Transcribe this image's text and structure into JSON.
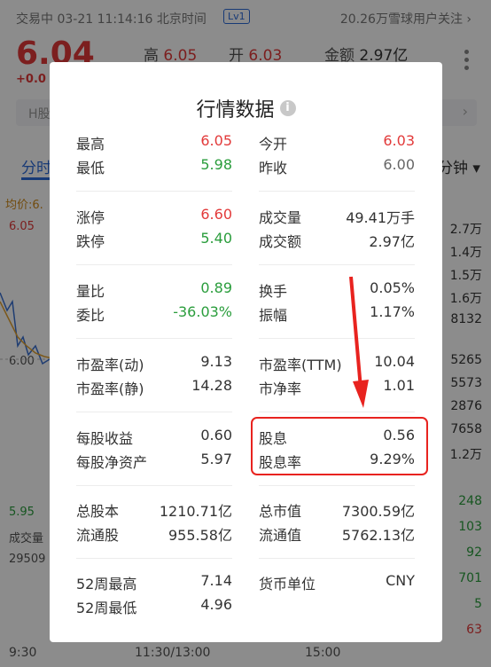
{
  "background": {
    "status_text": "交易中 03-21 11:14:16 北京时间",
    "level_badge": "Lv1",
    "followers": "20.26万雪球用户关注 ›",
    "price": "6.04",
    "change": "+0.0",
    "header": {
      "high_label": "高",
      "high_value": "6.05",
      "open_label": "开",
      "open_value": "6.03",
      "amount_label": "金额",
      "amount_value": "2.97亿"
    },
    "h_share_label": "H股",
    "tab_fenshi": "分时",
    "tab_minutes": "分钟 ▾",
    "avg_label": "均价:6.",
    "axis_high": "6.05",
    "axis_mid": "6.00",
    "axis_low": "5.95",
    "volume_label": "成交量",
    "volume_value": "29509",
    "right_col_top": [
      "2.7万",
      "1.4万",
      "1.5万",
      "1.6万",
      "8132"
    ],
    "right_col_mid": [
      "5265",
      "5573",
      "2876",
      "7658",
      "1.2万"
    ],
    "right_col_bottom": [
      "248",
      "103",
      "92",
      "701",
      "5",
      "63"
    ],
    "times": [
      "9:30",
      "11:30/13:00",
      "15:00"
    ]
  },
  "modal": {
    "title": "行情数据",
    "info_icon": "info-icon",
    "groups": [
      {
        "left": [
          {
            "label": "最高",
            "value": "6.05",
            "color": "red"
          },
          {
            "label": "最低",
            "value": "5.98",
            "color": "green"
          }
        ],
        "right": [
          {
            "label": "今开",
            "value": "6.03",
            "color": "red"
          },
          {
            "label": "昨收",
            "value": "6.00",
            "color": "gray"
          }
        ]
      },
      {
        "left": [
          {
            "label": "涨停",
            "value": "6.60",
            "color": "red"
          },
          {
            "label": "跌停",
            "value": "5.40",
            "color": "green"
          }
        ],
        "right": [
          {
            "label": "成交量",
            "value": "49.41万手",
            "color": "black"
          },
          {
            "label": "成交额",
            "value": "2.97亿",
            "color": "black"
          }
        ]
      },
      {
        "left": [
          {
            "label": "量比",
            "value": "0.89",
            "color": "green"
          },
          {
            "label": "委比",
            "value": "-36.03%",
            "color": "green"
          }
        ],
        "right": [
          {
            "label": "换手",
            "value": "0.05%",
            "color": "black"
          },
          {
            "label": "振幅",
            "value": "1.17%",
            "color": "black"
          }
        ]
      },
      {
        "left": [
          {
            "label": "市盈率(动)",
            "value": "9.13",
            "color": "black"
          },
          {
            "label": "市盈率(静)",
            "value": "14.28",
            "color": "black"
          }
        ],
        "right": [
          {
            "label": "市盈率(TTM)",
            "value": "10.04",
            "color": "black"
          },
          {
            "label": "市净率",
            "value": "1.01",
            "color": "black"
          }
        ]
      },
      {
        "left": [
          {
            "label": "每股收益",
            "value": "0.60",
            "color": "black"
          },
          {
            "label": "每股净资产",
            "value": "5.97",
            "color": "black"
          }
        ],
        "right": [
          {
            "label": "股息",
            "value": "0.56",
            "color": "black"
          },
          {
            "label": "股息率",
            "value": "9.29%",
            "color": "black"
          }
        ]
      },
      {
        "left": [
          {
            "label": "总股本",
            "value": "1210.71亿",
            "color": "black"
          },
          {
            "label": "流通股",
            "value": "955.58亿",
            "color": "black"
          }
        ],
        "right": [
          {
            "label": "总市值",
            "value": "7300.59亿",
            "color": "black"
          },
          {
            "label": "流通值",
            "value": "5762.13亿",
            "color": "black"
          }
        ]
      },
      {
        "left": [
          {
            "label": "52周最高",
            "value": "7.14",
            "color": "black"
          },
          {
            "label": "52周最低",
            "value": "4.96",
            "color": "black"
          }
        ],
        "right": [
          {
            "label": "货币单位",
            "value": "CNY",
            "color": "black"
          }
        ]
      }
    ]
  },
  "colors": {
    "red": "#e23a3a",
    "green": "#2a9d3c",
    "accent": "#2d6bd8",
    "annotation": "#e8231f"
  }
}
